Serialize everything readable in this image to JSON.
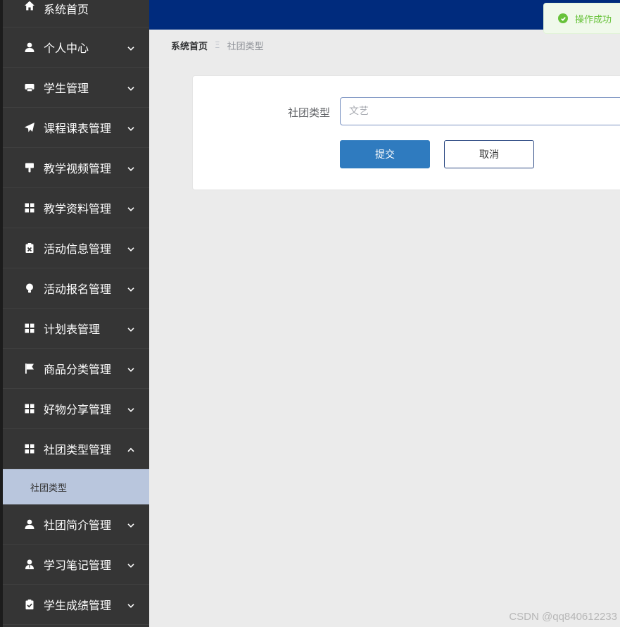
{
  "sidebar": {
    "items": [
      {
        "label": "系统首页",
        "icon": "home-icon"
      },
      {
        "label": "个人中心",
        "icon": "user-icon"
      },
      {
        "label": "学生管理",
        "icon": "printer-icon"
      },
      {
        "label": "课程课表管理",
        "icon": "paper-plane-icon"
      },
      {
        "label": "教学视频管理",
        "icon": "brush-icon"
      },
      {
        "label": "教学资料管理",
        "icon": "grid-icon"
      },
      {
        "label": "活动信息管理",
        "icon": "clipboard-x-icon"
      },
      {
        "label": "活动报名管理",
        "icon": "bulb-icon"
      },
      {
        "label": "计划表管理",
        "icon": "grid-icon"
      },
      {
        "label": "商品分类管理",
        "icon": "flag-icon"
      },
      {
        "label": "好物分享管理",
        "icon": "grid-icon"
      },
      {
        "label": "社团类型管理",
        "icon": "grid-icon"
      },
      {
        "label": "社团简介管理",
        "icon": "user-icon"
      },
      {
        "label": "学习笔记管理",
        "icon": "user-tie-icon"
      },
      {
        "label": "学生成绩管理",
        "icon": "clipboard-check-icon"
      }
    ],
    "submenu_label": "社团类型"
  },
  "toast": {
    "message": "操作成功",
    "color": "#67c23a"
  },
  "breadcrumb": {
    "home": "系统首页",
    "separator": "Ξ",
    "current": "社团类型"
  },
  "form": {
    "label": "社团类型",
    "value": "",
    "placeholder": "文艺",
    "submit_label": "提交",
    "cancel_label": "取消"
  },
  "watermark": "CSDN @qq840612233",
  "colors": {
    "topbar": "#002b7d",
    "sidebar": "#353535",
    "submit": "#2f7bbf",
    "submenu_active": "#b9c6dd"
  }
}
